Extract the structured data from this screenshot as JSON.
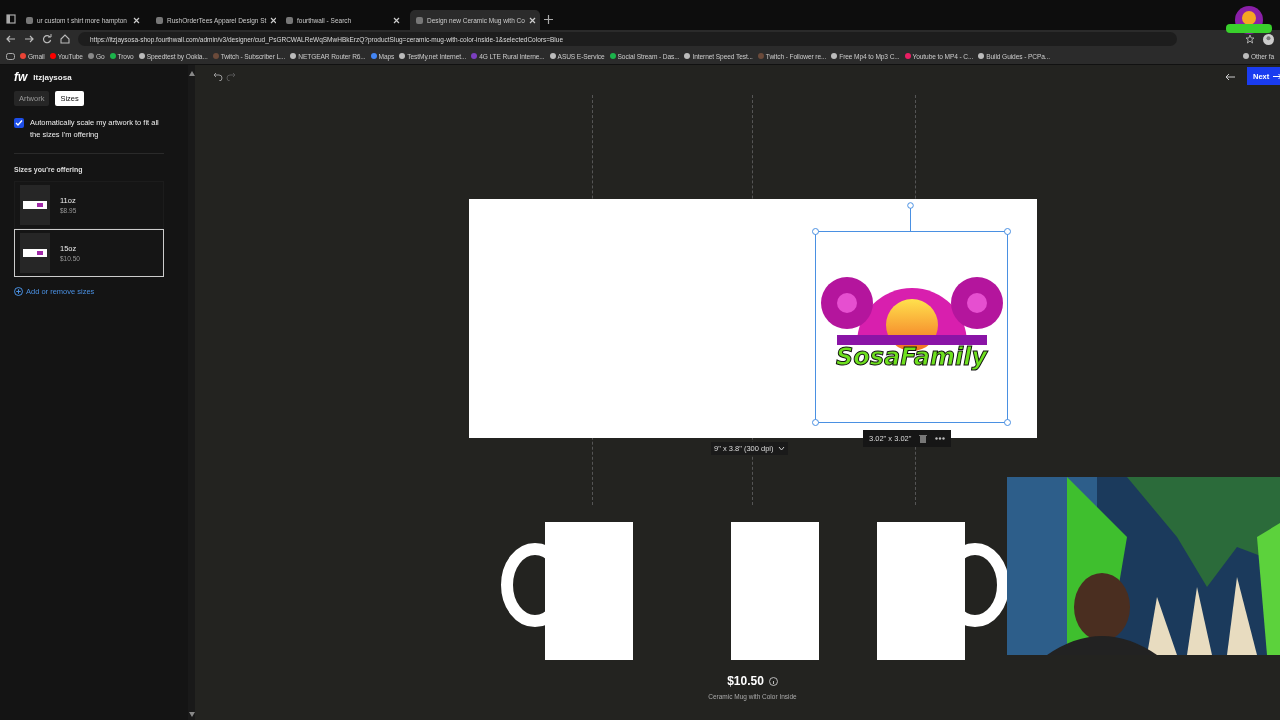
{
  "browser": {
    "tabs": [
      {
        "title": "ur custom t shirt more hampton",
        "selected": false
      },
      {
        "title": "RushOrderTees Apparel Design St",
        "selected": false
      },
      {
        "title": "fourthwall - Search",
        "selected": false
      },
      {
        "title": "Design new Ceramic Mug with Co",
        "selected": true
      }
    ],
    "url": "https://itzjaysosa-shop.fourthwall.com/admin/v3/designer/cud_PsGRCWALReWqSMwHBkErzQ?productSlug=ceramic-mug-with-color-inside-1&selectedColors=Blue",
    "bookmarks": [
      "Gmail",
      "YouTube",
      "Go",
      "Trovo",
      "Speedtest by Ookla...",
      "Twitch - Subscriber L...",
      "NETGEAR Router R6...",
      "Maps",
      "TestMy.net Internet...",
      "4G LTE Rural Interne...",
      "ASUS E-Service",
      "Social Stream - Das...",
      "Internet Speed Test...",
      "Twitch - Follower re...",
      "Free Mp4 to Mp3 C...",
      "Youtube to MP4 - C...",
      "Build Guides - PCPa..."
    ],
    "other_bookmarks": "Other fa"
  },
  "sidebar": {
    "brand": "fw",
    "user": "Itzjaysosa",
    "tabs": [
      {
        "label": "Artwork",
        "selected": false
      },
      {
        "label": "Sizes",
        "selected": true
      }
    ],
    "auto_scale": {
      "label": "Automatically scale my artwork to fit all the sizes I'm offering",
      "checked": true
    },
    "sizes_heading": "Sizes you're offering",
    "sizes": [
      {
        "name": "11oz",
        "price": "$8.95",
        "selected": false
      },
      {
        "name": "15oz",
        "price": "$10.50",
        "selected": true
      }
    ],
    "add_link": "Add or remove sizes"
  },
  "editor": {
    "next_button": "Next",
    "print_area": "9\" x 3.8\" (300 dpi)",
    "artwork": {
      "size": "3.02\" x 3.02\"",
      "text": "SosaFamily"
    },
    "mugs": [
      {
        "kind": "handle-left"
      },
      {
        "kind": "front"
      },
      {
        "kind": "handle-right"
      }
    ],
    "price": "$10.50",
    "product": "Ceramic Mug with Color Inside"
  }
}
